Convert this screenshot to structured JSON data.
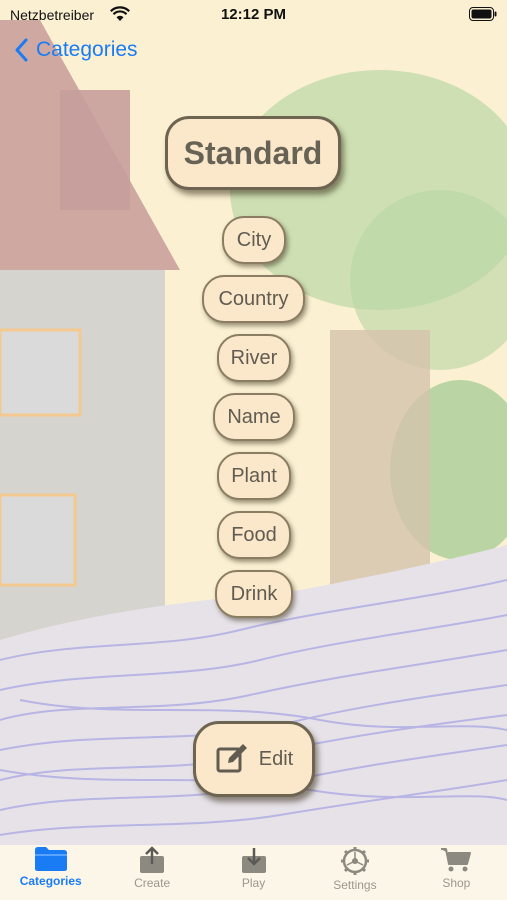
{
  "status_bar": {
    "carrier": "Netzbetreiber",
    "time": "12:12 PM"
  },
  "nav": {
    "back_label": "Categories"
  },
  "title": "Standard",
  "categories": [
    "City",
    "Country",
    "River",
    "Name",
    "Plant",
    "Food",
    "Drink"
  ],
  "edit_label": "Edit",
  "tabs": [
    {
      "label": "Categories",
      "icon": "folder-icon",
      "active": true
    },
    {
      "label": "Create",
      "icon": "upload-icon",
      "active": false
    },
    {
      "label": "Play",
      "icon": "download-icon",
      "active": false
    },
    {
      "label": "Settings",
      "icon": "gear-icon",
      "active": false
    },
    {
      "label": "Shop",
      "icon": "cart-icon",
      "active": false
    }
  ],
  "colors": {
    "accent": "#1a7cf5",
    "pill_fill": "#fbe7c9",
    "pill_border": "#6e6452",
    "background": "#fbf1d2"
  }
}
